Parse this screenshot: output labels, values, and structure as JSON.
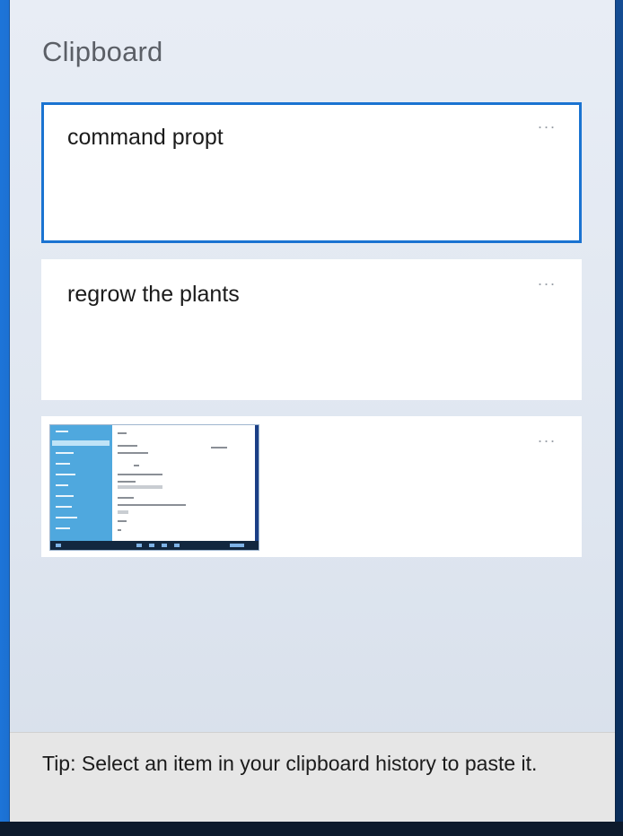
{
  "panel": {
    "title": "Clipboard"
  },
  "items": [
    {
      "text": "command propt",
      "more_label": "...",
      "selected": true
    },
    {
      "text": "regrow the plants",
      "more_label": "...",
      "selected": false
    },
    {
      "type": "image",
      "more_label": "...",
      "selected": false
    }
  ],
  "tip": {
    "text": "Tip: Select an item in your clipboard history to paste it."
  },
  "colors": {
    "accent": "#1a73d1",
    "panel_bg": "#e3e9f2",
    "card_bg": "#ffffff",
    "tip_bg": "#e6e6e6"
  }
}
